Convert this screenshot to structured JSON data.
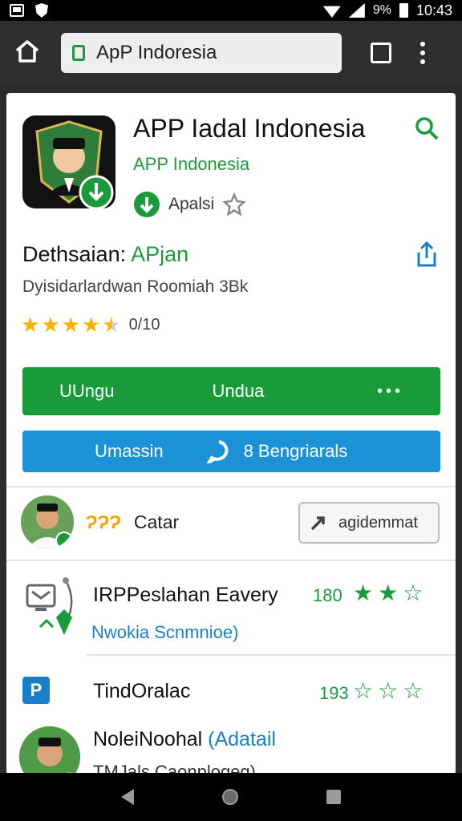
{
  "status_bar": {
    "time": "10:43",
    "battery": "9%",
    "icons": [
      "notification-icon",
      "shield-icon",
      "wifi-icon",
      "signal-icon",
      "battery-icon"
    ]
  },
  "browser": {
    "url": "ApP Indoresia",
    "icons": [
      "home-icon",
      "lock-icon",
      "tabs-icon",
      "menu-icon"
    ]
  },
  "app": {
    "title": "APP Iadal Indonesia",
    "developer": "APP Indonesia",
    "type_label": "Apalsi",
    "detail_prefix": "Dethsaian:",
    "detail_accent": "APjan",
    "size_line": "Dyisidarlardwan Roomiah 3Bk",
    "rating_count": "0/10",
    "rating_value": 4.5
  },
  "actions": {
    "green_btn_1": "UUngu",
    "green_btn_2": "Undua",
    "green_more": "•••",
    "blue_btn_1": "Umassin",
    "blue_btn_2": "8 Bengriarals"
  },
  "user_row": {
    "tag": "ɁɁɁ",
    "label": "Catar",
    "add_button": "agidemmat"
  },
  "list": [
    {
      "title": "IRPPeslahan Eavery",
      "subtitle": "Nwokia Scnmnioe)",
      "score": "180",
      "stars": [
        1,
        1,
        0
      ]
    },
    {
      "title": "TindOralac",
      "subtitle": "",
      "score": "193",
      "stars": [
        0,
        0,
        0
      ]
    },
    {
      "title": "NoleiNoohal",
      "subtitle": "(Adatail",
      "extra": "TMJals Caonplogeg)",
      "score": "",
      "stars": []
    }
  ],
  "colors": {
    "green": "#1a9b3a",
    "blue": "#1b92d6",
    "star": "#f5b400",
    "link": "#1b7ec8"
  }
}
